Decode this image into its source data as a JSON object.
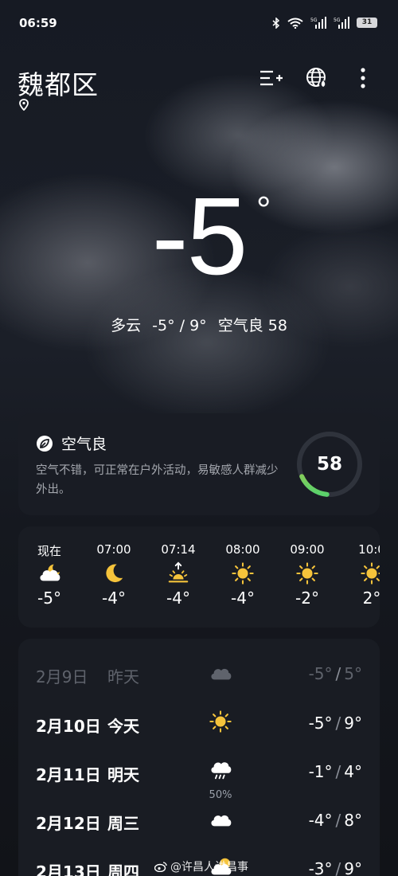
{
  "status": {
    "time": "06:59",
    "battery": "31",
    "net1": "5G",
    "net2": "5G"
  },
  "header": {
    "city": "魏都区"
  },
  "current": {
    "temp": "-5",
    "degree": "°",
    "condition": "多云",
    "range": "-5° / 9°",
    "aqi_text": "空气良 58"
  },
  "air": {
    "title": "空气良",
    "description": "空气不错，可正常在户外活动，易敏感人群减少外出。",
    "value": "58",
    "fraction": 0.17,
    "colors": [
      "#5ad16b",
      "#f2c230"
    ]
  },
  "hourly": [
    {
      "time": "现在",
      "icon": "partly-cloudy-night-icon",
      "temp": "-5°"
    },
    {
      "time": "07:00",
      "icon": "moon-icon",
      "temp": "-4°"
    },
    {
      "time": "07:14",
      "icon": "sunrise-icon",
      "temp": "-4°"
    },
    {
      "time": "08:00",
      "icon": "sun-icon",
      "temp": "-4°"
    },
    {
      "time": "09:00",
      "icon": "sun-icon",
      "temp": "-2°"
    },
    {
      "time": "10:0",
      "icon": "sun-icon",
      "temp": "2°"
    }
  ],
  "daily": [
    {
      "date": "2月9日",
      "label": "昨天",
      "icon": "cloud-icon",
      "low": "-5°",
      "high": "5°",
      "pop": ""
    },
    {
      "date": "2月10日",
      "label": "今天",
      "icon": "sun-icon",
      "low": "-5°",
      "high": "9°",
      "pop": ""
    },
    {
      "date": "2月11日",
      "label": "明天",
      "icon": "rain-cloud-icon",
      "low": "-1°",
      "high": "4°",
      "pop": "50%"
    },
    {
      "date": "2月12日",
      "label": "周三",
      "icon": "cloud-icon",
      "low": "-4°",
      "high": "8°",
      "pop": ""
    },
    {
      "date": "2月13日",
      "label": "周四",
      "icon": "partly-cloudy-icon",
      "low": "-3°",
      "high": "9°",
      "pop": ""
    }
  ],
  "watermark": "@许昌人讲昌事",
  "colors": {
    "sun": "#f5c33b",
    "moon": "#f5c33b"
  }
}
